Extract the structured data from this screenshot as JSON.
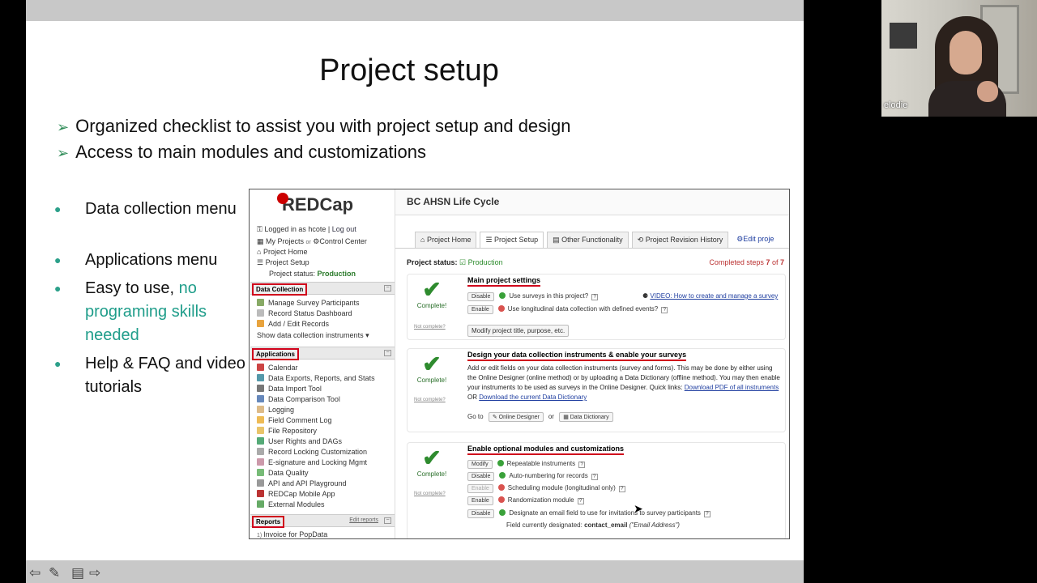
{
  "slide": {
    "title": "Project setup",
    "arrow_points": [
      "Organized checklist to assist you with project setup and design",
      "Access to main modules and customizations"
    ],
    "bullets": [
      {
        "text": "Data collection menu"
      },
      {
        "text": "Applications menu"
      },
      {
        "text_a": "Easy to use, ",
        "text_b": "no programing skills needed"
      },
      {
        "text": "Help & FAQ and video tutorials"
      }
    ]
  },
  "webcam": {
    "name": "elodie"
  },
  "redcap": {
    "logo": "REDCap",
    "project_title": "BC AHSN Life Cycle",
    "logged_in": "Logged in as hcote",
    "log_out": "Log out",
    "nav": {
      "my_projects": "My Projects",
      "or": "or",
      "control_center": "Control Center",
      "project_home": "Project Home",
      "project_setup": "Project Setup",
      "project_status_label": "Project status:",
      "project_status_value": "Production"
    },
    "sections": {
      "data_collection": {
        "label": "Data Collection",
        "items": [
          "Manage Survey Participants",
          "Record Status Dashboard",
          "Add / Edit Records"
        ],
        "show_instruments": "Show data collection instruments ▾"
      },
      "applications": {
        "label": "Applications",
        "items": [
          "Calendar",
          "Data Exports, Reports, and Stats",
          "Data Import Tool",
          "Data Comparison Tool",
          "Logging",
          "Field Comment Log",
          "File Repository",
          "User Rights  and  DAGs",
          "Record Locking Customization",
          "E-signature and Locking Mgmt",
          "Data Quality",
          "API  and  API Playground",
          "REDCap Mobile App",
          "External Modules"
        ]
      },
      "reports": {
        "label": "Reports",
        "edit": "Edit reports",
        "items": [
          "Invoice for PopData"
        ]
      }
    },
    "tabs": [
      "Project Home",
      "Project Setup",
      "Other Functionality",
      "Project Revision History",
      "Edit proje"
    ],
    "status": {
      "label": "Project status:",
      "value": "Production",
      "completed": "Completed steps",
      "done": "7",
      "of": "of",
      "total": "7"
    },
    "cards": [
      {
        "title": "Main project settings",
        "complete": "Complete!",
        "not_complete": "Not complete?",
        "rows": [
          {
            "btn": "Disable",
            "text": "Use surveys in this project?",
            "video": "VIDEO: How to create and manage a survey"
          },
          {
            "btn": "Enable",
            "text": "Use longitudinal data collection with defined events?"
          }
        ],
        "modify": "Modify project title, purpose, etc."
      },
      {
        "title": "Design your data collection instruments & enable your surveys",
        "complete": "Complete!",
        "not_complete": "Not complete?",
        "desc": "Add or edit fields on your data collection instruments (survey and forms). This may be done by either using the Online Designer (online method) or by uploading a Data Dictionary (offline method). You may then enable your instruments to be used as surveys in the Online Designer.",
        "quick": "Quick links:",
        "link1": "Download PDF of all instruments",
        "or": "OR",
        "link2": "Download the current Data Dictionary",
        "goto": "Go to",
        "online_designer": "Online Designer",
        "or2": "or",
        "data_dictionary": "Data Dictionary"
      },
      {
        "title": "Enable optional modules and customizations",
        "complete": "Complete!",
        "not_complete": "Not complete?",
        "rows": [
          {
            "btn": "Modify",
            "text": "Repeatable instruments",
            "status": "on"
          },
          {
            "btn": "Disable",
            "text": "Auto-numbering for records",
            "status": "on"
          },
          {
            "btn": "Enable",
            "text": "Scheduling module (longitudinal only)",
            "status": "off"
          },
          {
            "btn": "Enable",
            "text": "Randomization module",
            "status": "off"
          },
          {
            "btn": "Disable",
            "text": "Designate an email field to use for invitations to survey participants",
            "status": "on"
          }
        ],
        "field_label": "Field currently designated:",
        "field_value": "contact_email",
        "field_desc": "(\"Email Address\")"
      }
    ]
  }
}
